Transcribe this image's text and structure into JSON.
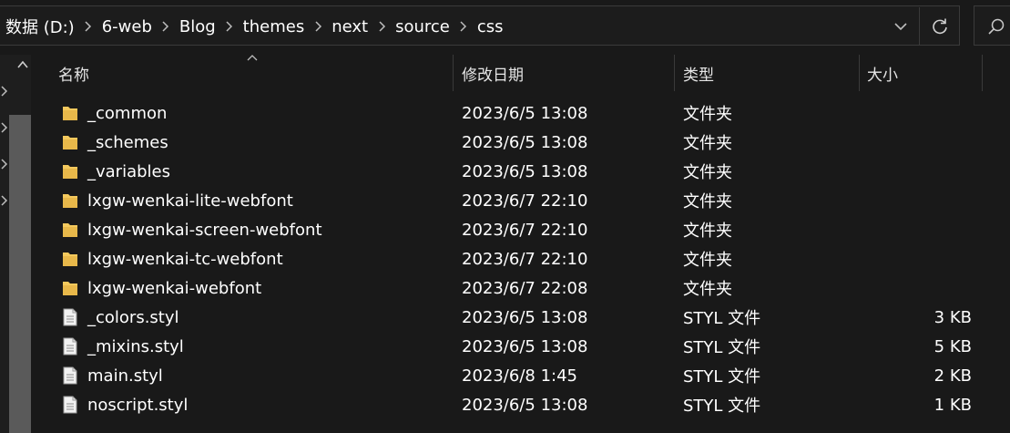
{
  "breadcrumbs": [
    "数据 (D:)",
    "6-web",
    "Blog",
    "themes",
    "next",
    "source",
    "css"
  ],
  "columns": {
    "name": "名称",
    "date": "修改日期",
    "type": "类型",
    "size": "大小"
  },
  "files": [
    {
      "icon": "folder-icon",
      "name": "_common",
      "date": "2023/6/5 13:08",
      "type": "文件夹",
      "size": ""
    },
    {
      "icon": "folder-icon",
      "name": "_schemes",
      "date": "2023/6/5 13:08",
      "type": "文件夹",
      "size": ""
    },
    {
      "icon": "folder-icon",
      "name": "_variables",
      "date": "2023/6/5 13:08",
      "type": "文件夹",
      "size": ""
    },
    {
      "icon": "folder-icon",
      "name": "lxgw-wenkai-lite-webfont",
      "date": "2023/6/7 22:10",
      "type": "文件夹",
      "size": ""
    },
    {
      "icon": "folder-icon",
      "name": "lxgw-wenkai-screen-webfont",
      "date": "2023/6/7 22:10",
      "type": "文件夹",
      "size": ""
    },
    {
      "icon": "folder-icon",
      "name": "lxgw-wenkai-tc-webfont",
      "date": "2023/6/7 22:10",
      "type": "文件夹",
      "size": ""
    },
    {
      "icon": "folder-icon",
      "name": "lxgw-wenkai-webfont",
      "date": "2023/6/7 22:08",
      "type": "文件夹",
      "size": ""
    },
    {
      "icon": "file-icon",
      "name": "_colors.styl",
      "date": "2023/6/5 13:08",
      "type": "STYL 文件",
      "size": "3 KB"
    },
    {
      "icon": "file-icon",
      "name": "_mixins.styl",
      "date": "2023/6/5 13:08",
      "type": "STYL 文件",
      "size": "5 KB"
    },
    {
      "icon": "file-icon",
      "name": "main.styl",
      "date": "2023/6/8 1:45",
      "type": "STYL 文件",
      "size": "2 KB"
    },
    {
      "icon": "file-icon",
      "name": "noscript.styl",
      "date": "2023/6/5 13:08",
      "type": "STYL 文件",
      "size": "1 KB"
    }
  ],
  "colors": {
    "background": "#191919",
    "folder": "#f4c95d",
    "text": "#ffffff",
    "divider": "#3a3a3a",
    "scroll_thumb": "#5a5a5a"
  },
  "icons": [
    "chevron-right-icon",
    "chevron-down-icon",
    "refresh-icon",
    "search-icon",
    "sort-up-icon",
    "folder-icon",
    "file-icon"
  ]
}
